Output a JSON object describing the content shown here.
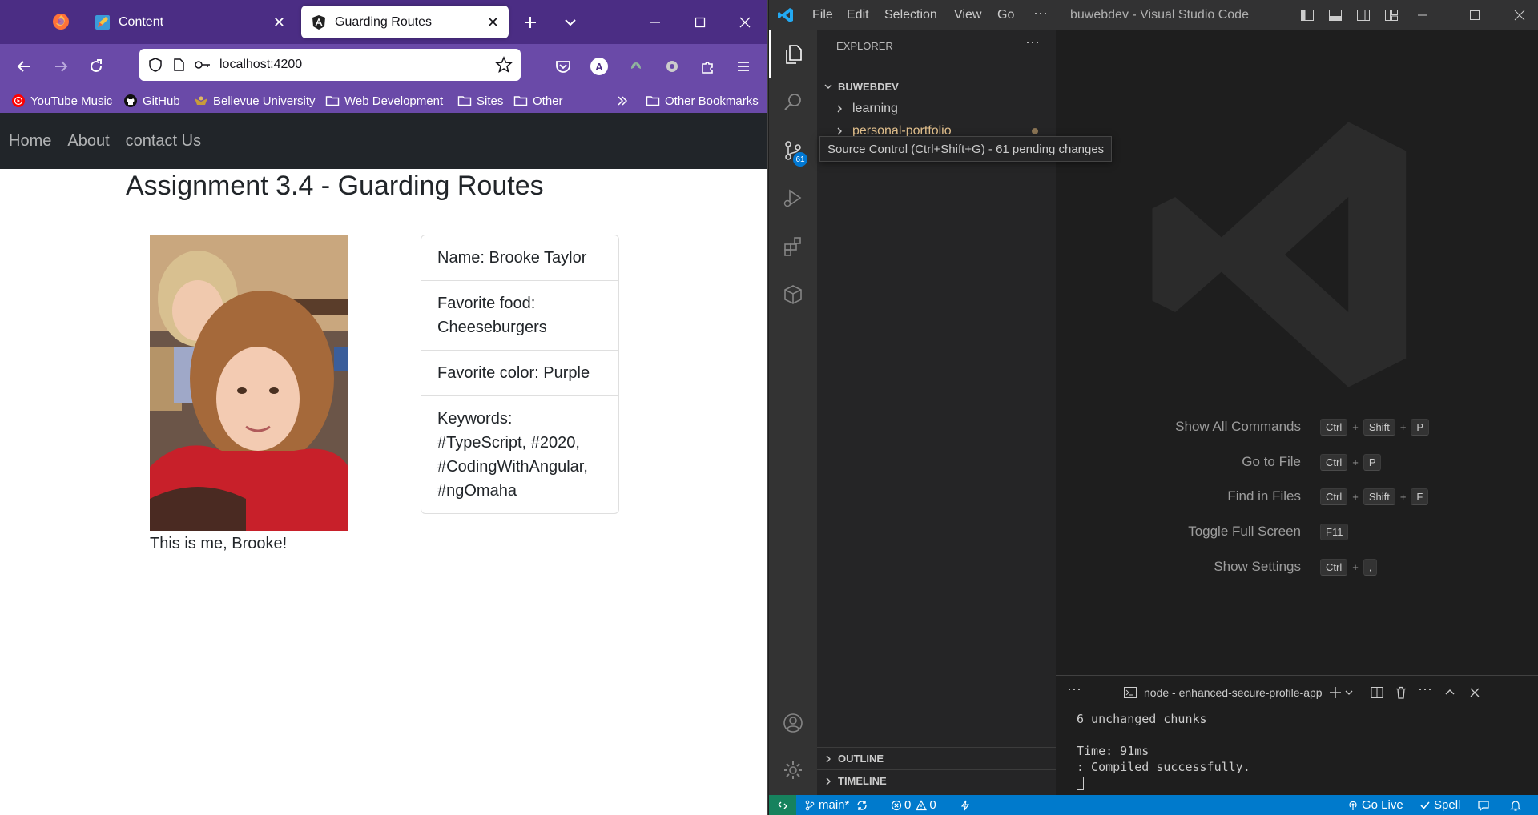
{
  "firefox": {
    "tabs": [
      {
        "title": "Content"
      },
      {
        "title": "Guarding Routes"
      }
    ],
    "url": "localhost:4200",
    "bookmarks": [
      "YouTube Music",
      "GitHub",
      "Bellevue University",
      "Web Development",
      "Sites",
      "Other"
    ],
    "other_bookmarks": "Other Bookmarks",
    "account_initial": "A"
  },
  "page": {
    "nav": [
      "Home",
      "About",
      "contact Us"
    ],
    "title": "Assignment 3.4 - Guarding Routes",
    "caption": "This is me, Brooke!",
    "card": [
      "Name: Brooke Taylor",
      "Favorite food: Cheeseburgers",
      "Favorite color: Purple",
      "Keywords: #TypeScript, #2020, #CodingWithAngular, #ngOmaha"
    ]
  },
  "vscode": {
    "menu": [
      "File",
      "Edit",
      "Selection",
      "View",
      "Go"
    ],
    "window_title": "buwebdev - Visual Studio Code",
    "explorer_label": "EXPLORER",
    "workspace": "BUWEBDEV",
    "folders": [
      "learning",
      "personal-portfolio"
    ],
    "scm_badge": "61",
    "tooltip": "Source Control (Ctrl+Shift+G) - 61 pending changes",
    "shortcuts": [
      {
        "label": "Show All Commands",
        "keys": [
          "Ctrl",
          "Shift",
          "P"
        ]
      },
      {
        "label": "Go to File",
        "keys": [
          "Ctrl",
          "P"
        ]
      },
      {
        "label": "Find in Files",
        "keys": [
          "Ctrl",
          "Shift",
          "F"
        ]
      },
      {
        "label": "Toggle Full Screen",
        "keys": [
          "F11"
        ]
      },
      {
        "label": "Show Settings",
        "keys": [
          "Ctrl",
          ","
        ]
      }
    ],
    "outline": "OUTLINE",
    "timeline": "TIMELINE",
    "terminal_name": "node - enhanced-secure-profile-app",
    "terminal_lines": [
      "6 unchanged chunks",
      "",
      "Time: 91ms",
      ": Compiled successfully."
    ],
    "status": {
      "branch": "main*",
      "errors": "0",
      "warnings": "0",
      "go_live": "Go Live",
      "spell": "Spell"
    },
    "colors": {
      "statusbar": "#007acc",
      "modified_folder": "#e2c08d"
    }
  }
}
